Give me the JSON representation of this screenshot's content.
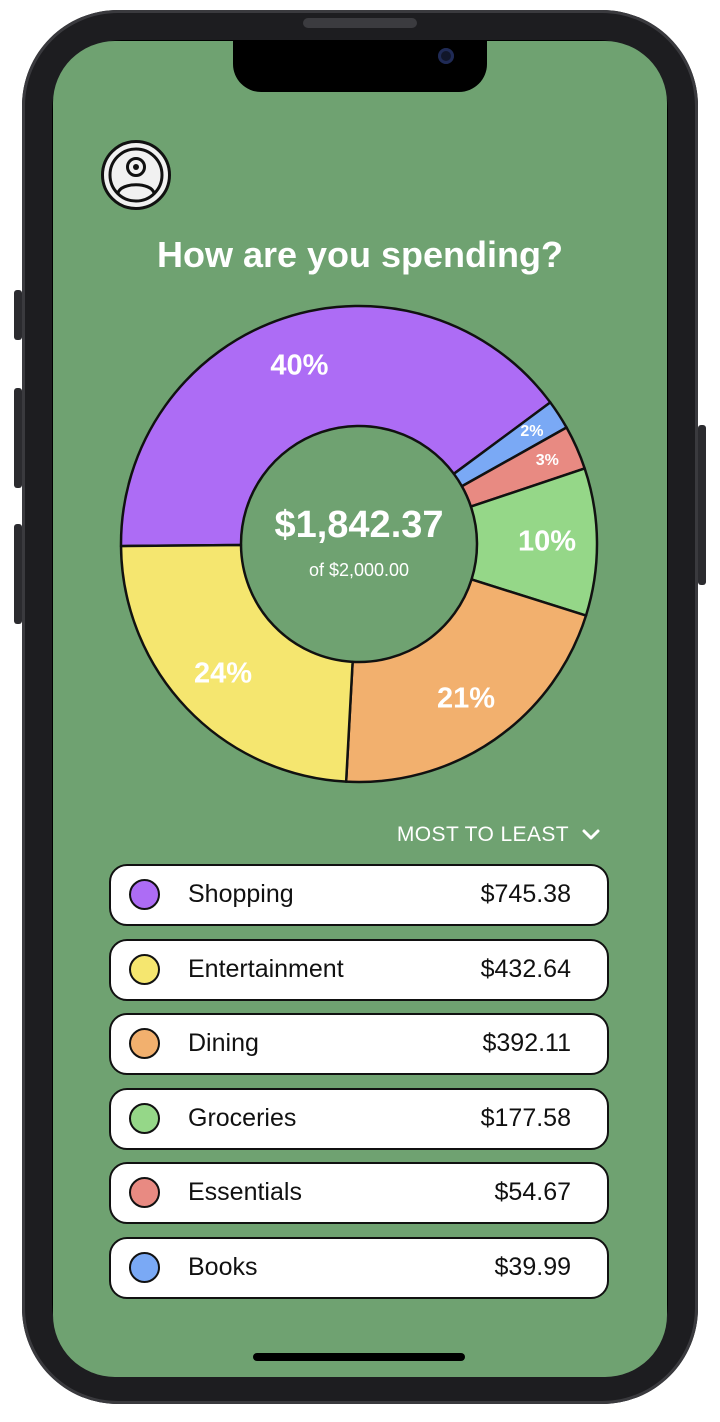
{
  "header": {
    "title": "How are you spending?",
    "avatar_icon": "user-circle-icon"
  },
  "summary": {
    "spent": "$1,842.37",
    "budget_text": "of $2,000.00"
  },
  "colors": {
    "screen_bg": "#6fa271",
    "Shopping": "#ad6cf5",
    "Entertainment": "#f5e66f",
    "Dining": "#f2b06e",
    "Groceries": "#95d788",
    "Essentials": "#e88a82",
    "Books": "#7aa9f5"
  },
  "chart_data": {
    "type": "pie",
    "donut": true,
    "categories": [
      "Shopping",
      "Entertainment",
      "Dining",
      "Groceries",
      "Essentials",
      "Books"
    ],
    "values": [
      40,
      24,
      21,
      10,
      3,
      2
    ],
    "labels": [
      "40%",
      "24%",
      "21%",
      "10%",
      "3%",
      "2%"
    ],
    "units": "%"
  },
  "sort": {
    "label": "MOST TO LEAST",
    "icon": "chevron-down-icon"
  },
  "categories": [
    {
      "name": "Shopping",
      "amount": "$745.38",
      "color": "#ad6cf5"
    },
    {
      "name": "Entertainment",
      "amount": "$432.64",
      "color": "#f5e66f"
    },
    {
      "name": "Dining",
      "amount": "$392.11",
      "color": "#f2b06e"
    },
    {
      "name": "Groceries",
      "amount": "$177.58",
      "color": "#95d788"
    },
    {
      "name": "Essentials",
      "amount": "$54.67",
      "color": "#e88a82"
    },
    {
      "name": "Books",
      "amount": "$39.99",
      "color": "#7aa9f5"
    }
  ]
}
